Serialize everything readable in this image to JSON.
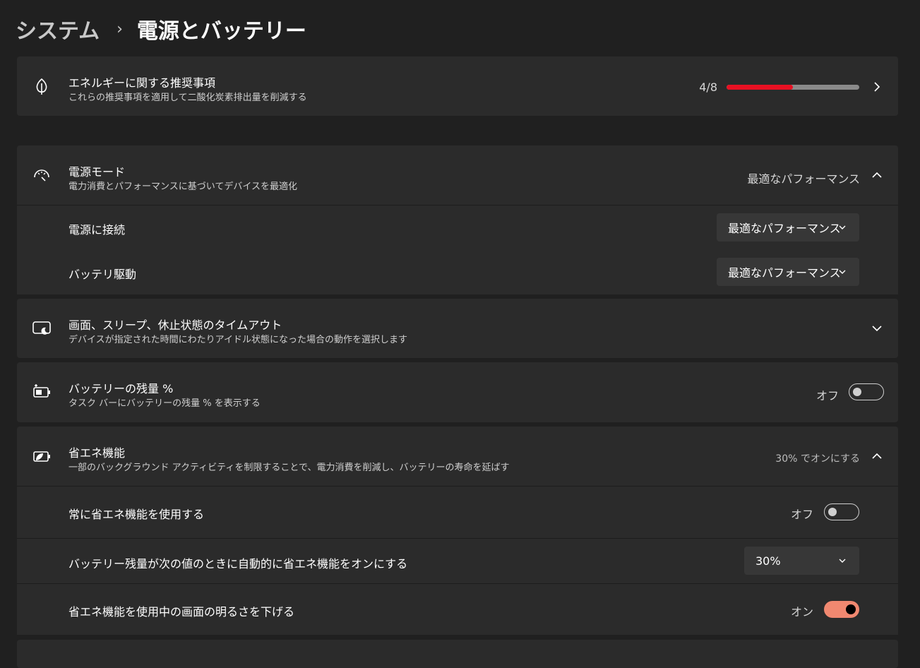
{
  "breadcrumb": {
    "parent": "システム",
    "separator": "›",
    "current": "電源とバッテリー"
  },
  "energy": {
    "title": "エネルギーに関する推奨事項",
    "desc": "これらの推奨事項を適用して二酸化炭素排出量を削減する",
    "progress_text": "4/8",
    "progress_fraction": 0.5,
    "progress_color": "#e81123",
    "icon": "leaf-icon"
  },
  "power_mode": {
    "title": "電源モード",
    "desc": "電力消費とパフォーマンスに基づいてデバイスを最適化",
    "value": "最適なパフォーマンス",
    "icon": "gauge-icon",
    "plugged_label": "電源に接続",
    "plugged_value": "最適なパフォーマンス",
    "battery_label": "バッテリ駆動",
    "battery_value": "最適なパフォーマンス"
  },
  "timeout": {
    "title": "画面、スリープ、休止状態のタイムアウト",
    "desc": "デバイスが指定された時間にわたりアイドル状態になった場合の動作を選択します",
    "icon": "screen-sleep-icon"
  },
  "battery_percent": {
    "title": "バッテリーの残量 %",
    "desc": "タスク バーにバッテリーの残量 % を表示する",
    "state_label": "オフ",
    "icon": "battery-icon"
  },
  "saver": {
    "title": "省エネ機能",
    "desc": "一部のバックグラウンド アクティビティを制限することで、電力消費を削減し、バッテリーの寿命を延ばす",
    "summary": "30% でオンにする",
    "icon": "battery-saver-icon",
    "always_label": "常に省エネ機能を使用する",
    "always_state": "オフ",
    "auto_label": "バッテリー残量が次の値のときに自動的に省エネ機能をオンにする",
    "auto_value": "30%",
    "dim_label": "省エネ機能を使用中の画面の明るさを下げる",
    "dim_state": "オン",
    "accent_color": "#f08870"
  }
}
